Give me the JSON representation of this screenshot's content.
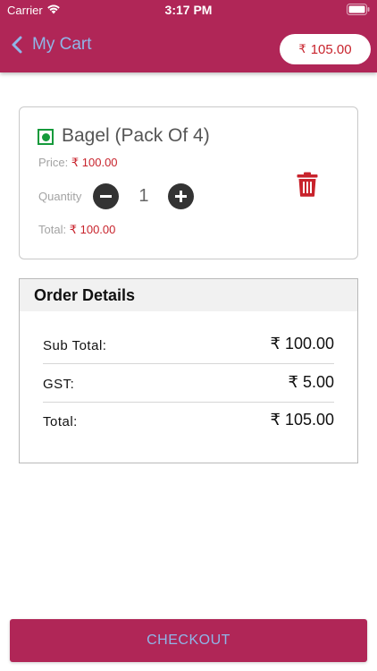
{
  "status_bar": {
    "carrier": "Carrier",
    "time": "3:17 PM"
  },
  "header": {
    "title": "My Cart",
    "cart_total": {
      "currency": "₹",
      "amount": "105.00"
    }
  },
  "cart_item": {
    "name": "Bagel (Pack Of 4)",
    "price_label": "Price:",
    "price_currency": "₹",
    "price": "100.00",
    "quantity_label": "Quantity",
    "quantity": "1",
    "total_label": "Total:",
    "total_currency": "₹",
    "total": "100.00"
  },
  "order_details": {
    "title": "Order Details",
    "rows": [
      {
        "label": "Sub Total:",
        "value": "₹ 100.00"
      },
      {
        "label": "GST:",
        "value": "₹ 5.00"
      },
      {
        "label": "Total:",
        "value": "₹ 105.00"
      }
    ]
  },
  "checkout": {
    "label": "CHECKOUT"
  },
  "colors": {
    "brand": "#b02657",
    "accent_text": "#8fb6e8",
    "price_red": "#c8232c",
    "veg_green": "#159a3b"
  },
  "icons": [
    "wifi-icon",
    "battery-icon",
    "back-chevron-icon",
    "veg-indicator-icon",
    "minus-icon",
    "plus-icon",
    "trash-icon"
  ]
}
